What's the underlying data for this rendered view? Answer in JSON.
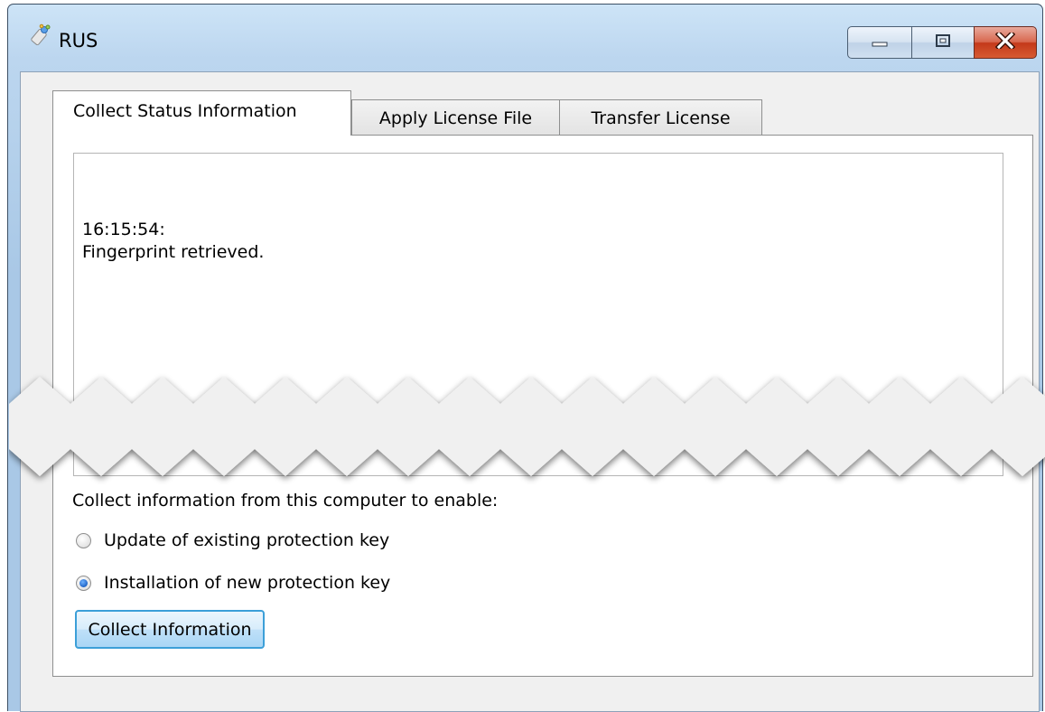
{
  "window": {
    "title": "RUS",
    "icons": {
      "app": "key-icon",
      "minimize": "minimize-icon",
      "maximize": "maximize-icon",
      "close": "close-icon"
    },
    "colors": {
      "close_button": "#c4391a",
      "title_bar": "#bcd6ef"
    }
  },
  "tabs": [
    {
      "label": "Collect Status Information",
      "active": true
    },
    {
      "label": "Apply License File",
      "active": false
    },
    {
      "label": "Transfer License",
      "active": false
    }
  ],
  "log": {
    "timestamp": "16:15:54:",
    "message": "Fingerprint retrieved."
  },
  "form": {
    "prompt": "Collect information from this computer to enable:",
    "options": [
      {
        "label": "Update of existing protection key",
        "selected": false
      },
      {
        "label": "Installation of new protection key",
        "selected": true
      }
    ],
    "collect_button": "Collect Information",
    "accent_color": "#3c9fd8"
  }
}
